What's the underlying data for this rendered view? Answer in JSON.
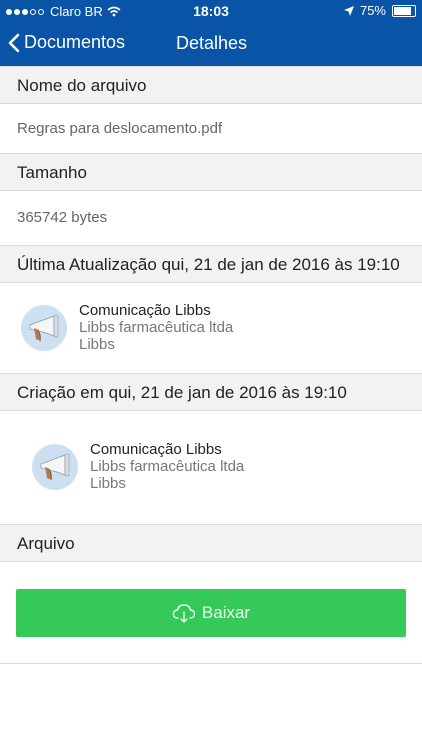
{
  "status": {
    "carrier": "Claro BR",
    "time": "18:03",
    "battery": "75%"
  },
  "nav": {
    "back_label": "Documentos",
    "title": "Detalhes"
  },
  "sections": {
    "filename_header": "Nome do arquivo",
    "filename_value": "Regras para deslocamento.pdf",
    "size_header": "Tamanho",
    "size_value": "365742 bytes",
    "updated_header": "Última Atualização qui, 21 de jan de 2016 às 19:10",
    "created_header": "Criação em qui, 21 de jan de 2016 às 19:10",
    "file_header": "Arquivo"
  },
  "updated_by": {
    "name": "Comunicação Libbs",
    "company": "Libbs farmacêutica ltda",
    "org": "Libbs"
  },
  "created_by": {
    "name": "Comunicação Libbs",
    "company": "Libbs farmacêutica ltda",
    "org": "Libbs"
  },
  "download": {
    "label": "Baixar",
    "color": "#35c95a"
  },
  "colors": {
    "brand": "#0a54a7"
  },
  "icons": [
    "back-chevron-icon",
    "wifi-icon",
    "location-arrow-icon",
    "battery-icon",
    "megaphone-icon",
    "cloud-download-icon"
  ]
}
